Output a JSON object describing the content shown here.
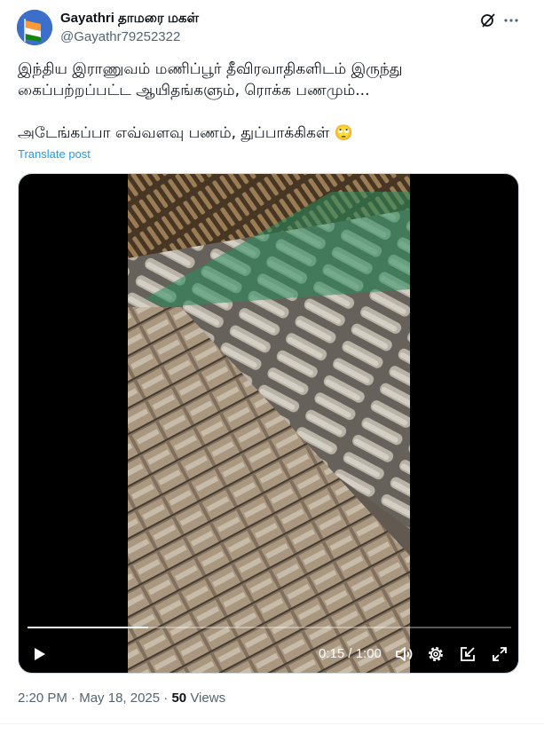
{
  "author": {
    "display_name": "Gayathri தாமரை மகள்",
    "handle": "@Gayathr79252322"
  },
  "post": {
    "text": "இந்திய இராணுவம் மணிப்பூர் தீவிரவாதிகளிடம் இருந்து\nகைப்பற்றப்பட்ட ஆயிதங்களும், ரொக்க பணமும்...\n\nஅடேங்கப்பா எவ்வளவு பணம், துப்பாக்கிகள் 🙄",
    "translate_label": "Translate post"
  },
  "video": {
    "time_display": "0:15 / 1:00",
    "progress_fraction": 0.25
  },
  "meta": {
    "time": "2:20 PM",
    "date": "May 18, 2025",
    "separator": "·",
    "views_count": "50",
    "views_label": "Views"
  },
  "icons": {
    "grok": "grok-icon",
    "more": "more-icon",
    "play": "play-icon",
    "volume": "volume-icon",
    "settings": "gear-icon",
    "pip": "picture-in-picture-icon",
    "fullscreen": "fullscreen-icon"
  },
  "colors": {
    "link": "#1d9bf0",
    "secondary_text": "#536471",
    "primary_text": "#0f1419"
  }
}
